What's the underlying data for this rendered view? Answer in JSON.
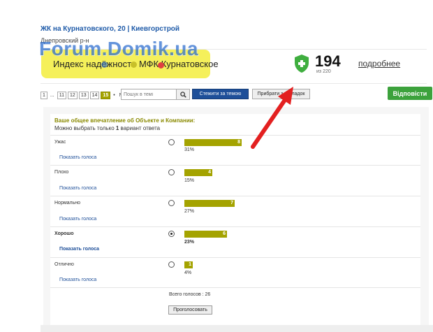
{
  "header": {
    "title": "ЖК на Курнатовского, 20 | Киевгорстрой",
    "district": "Днепровский р-н",
    "watermark": "Forum.Domik.ua"
  },
  "reliability": {
    "label": "Индекс надёжности МФК Курнатовское",
    "score": "194",
    "score_sub": "из 220",
    "details_link": "подробнее",
    "shield_color": "#3fae3f",
    "highlight_color": "#f5f05a"
  },
  "toolbar": {
    "pages": [
      "1",
      "...",
      "11",
      "12",
      "13",
      "14",
      "15",
      "•",
      "NI"
    ],
    "active_page": "15",
    "search_placeholder": "Пошук в темі",
    "follow_label": "Стежити за темою",
    "bookmark_label": "Прибрати з закладок",
    "reply_label": "Відповісти"
  },
  "poll": {
    "question": "Ваше общее впечатление об Объекте и Компании:",
    "hint_prefix": "Можно выбрать только ",
    "hint_count": "1",
    "hint_suffix": " вариант ответа",
    "show_votes_label": "Показать голоса",
    "options": [
      {
        "label": "Ужас",
        "votes": "8",
        "percent": "31%",
        "fraction": 0.31,
        "selected": false
      },
      {
        "label": "Плохо",
        "votes": "4",
        "percent": "15%",
        "fraction": 0.15,
        "selected": false
      },
      {
        "label": "Нормально",
        "votes": "7",
        "percent": "27%",
        "fraction": 0.27,
        "selected": false
      },
      {
        "label": "Хорошо",
        "votes": "6",
        "percent": "23%",
        "fraction": 0.23,
        "selected": true
      },
      {
        "label": "Отлично",
        "votes": "1",
        "percent": "4%",
        "fraction": 0.04,
        "selected": false
      }
    ],
    "total_label": "Всего голосов : 26",
    "vote_button": "Проголосовать",
    "bar_color": "#a4a300"
  },
  "annotation": {
    "arrow_color": "#e32020"
  }
}
